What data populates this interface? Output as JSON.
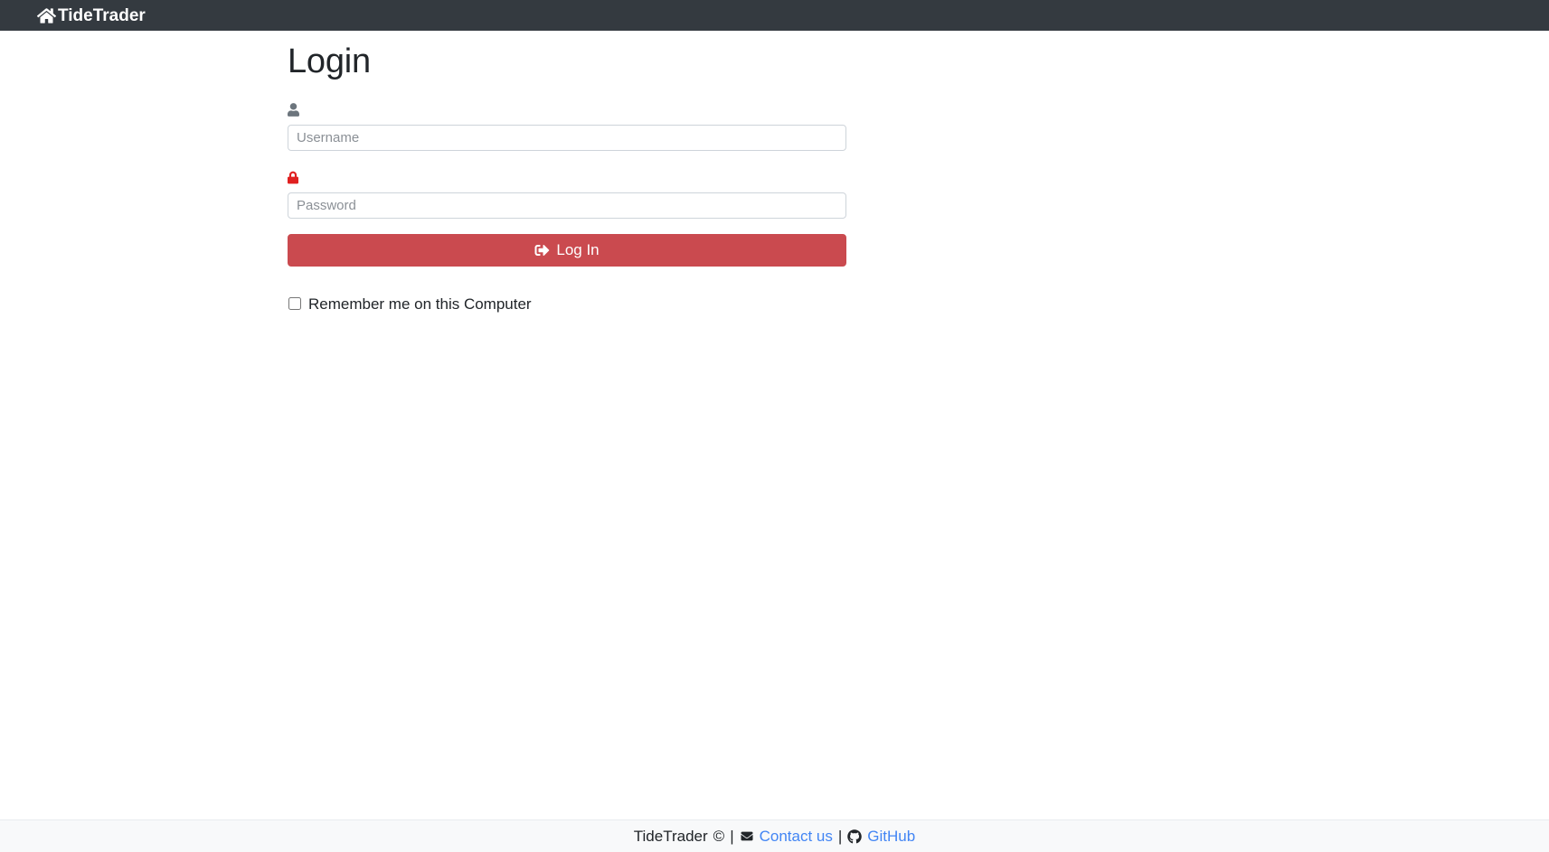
{
  "navbar": {
    "brand_label": "TideTrader",
    "brand_icon": "home-icon",
    "background_color": "#343a40"
  },
  "login": {
    "title": "Login",
    "username": {
      "icon": "user-icon",
      "icon_color": "#6c757d",
      "placeholder": "Username",
      "value": ""
    },
    "password": {
      "icon": "lock-icon",
      "icon_color": "#e02020",
      "placeholder": "Password",
      "value": ""
    },
    "submit": {
      "label": "Log In",
      "icon": "sign-in-icon",
      "background_color": "#ca4a4f"
    },
    "remember": {
      "label": "Remember me on this Computer",
      "checked": false
    }
  },
  "footer": {
    "brand": "TideTrader",
    "copyright_symbol": "©",
    "separator": "|",
    "contact": {
      "icon": "envelope-icon",
      "label": "Contact us"
    },
    "github": {
      "icon": "github-icon",
      "label": "GitHub"
    },
    "link_color": "#4285f4"
  }
}
